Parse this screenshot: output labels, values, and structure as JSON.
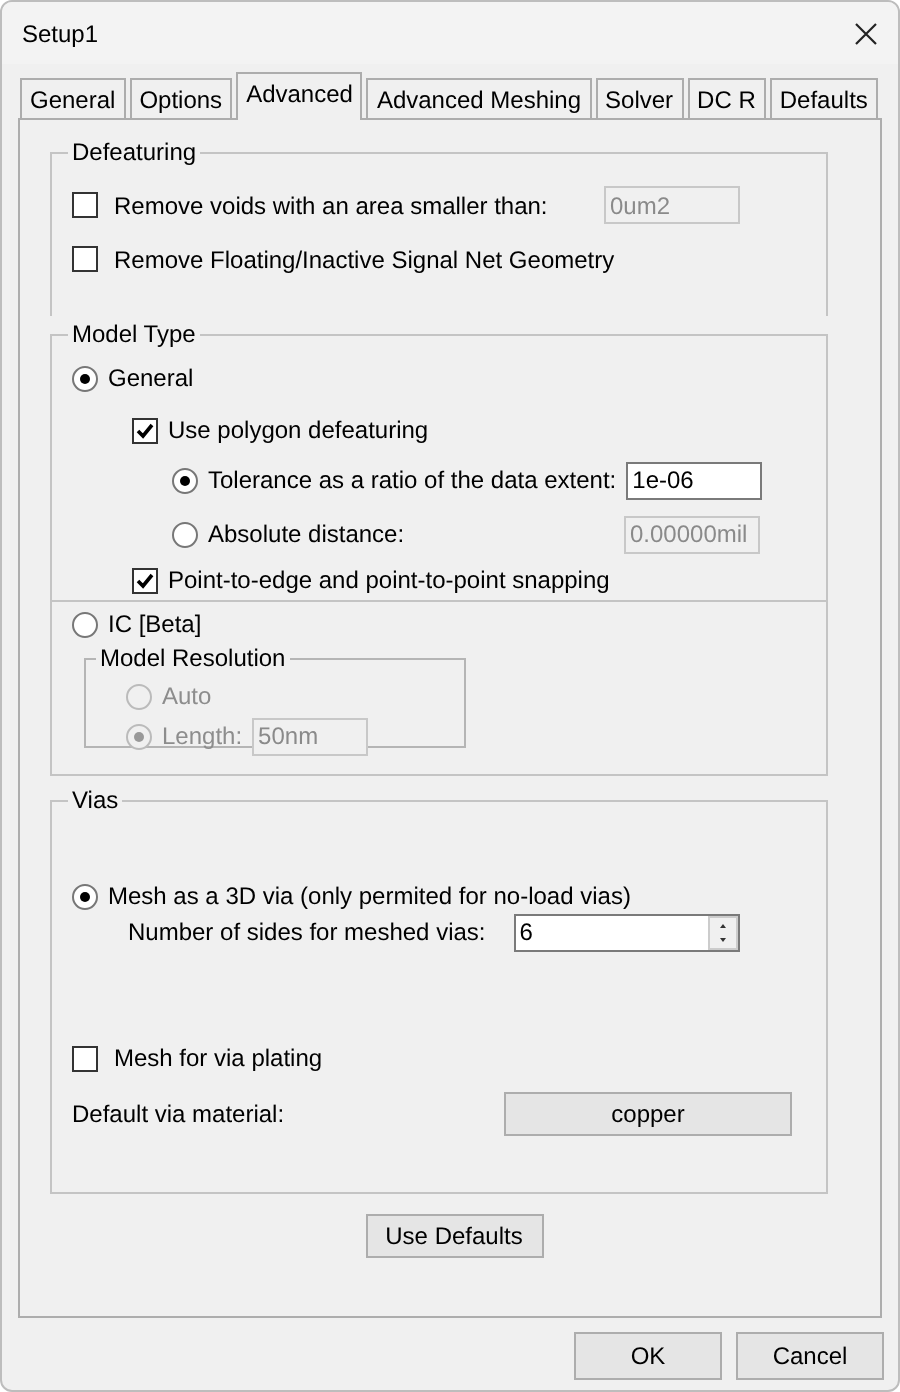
{
  "window": {
    "title": "Setup1"
  },
  "tabs": [
    {
      "label": "General",
      "selected": false
    },
    {
      "label": "Options",
      "selected": false
    },
    {
      "label": "Advanced",
      "selected": true
    },
    {
      "label": "Advanced Meshing",
      "selected": false
    },
    {
      "label": "Solver",
      "selected": false
    },
    {
      "label": "DC R",
      "selected": false
    },
    {
      "label": "Defaults",
      "selected": false
    }
  ],
  "defeaturing": {
    "title": "Defeaturing",
    "options": [
      {
        "label": "Remove voids with an area smaller than:",
        "checked": false,
        "value": "0um2",
        "disabled": true
      },
      {
        "label": "Remove Floating/Inactive Signal Net Geometry",
        "checked": false
      }
    ]
  },
  "model_type": {
    "title": "Model Type",
    "general": {
      "label": "General",
      "selected": true,
      "polygon": {
        "label": "Use polygon defeaturing",
        "checked": true
      },
      "tolerance": [
        {
          "label": "Tolerance as a ratio of the data extent:",
          "selected": true,
          "value": "1e-06",
          "disabled": false
        },
        {
          "label": "Absolute distance:",
          "selected": false,
          "value": "0.00000mil",
          "disabled": true
        }
      ],
      "snapping": {
        "label": "Point-to-edge and point-to-point snapping",
        "checked": true
      }
    },
    "ic": {
      "label": "IC [Beta]",
      "selected": false,
      "resolution": {
        "title": "Model Resolution",
        "disabled": true,
        "options": [
          {
            "label": "Auto",
            "selected": false
          },
          {
            "label": "Length:",
            "selected": true,
            "value": "50nm"
          }
        ]
      }
    }
  },
  "vias": {
    "title": "Vias",
    "mesh_3d": {
      "label": "Mesh as a 3D via (only permited for no-load vias)",
      "selected": true
    },
    "sides": {
      "label": "Number of sides for meshed vias:",
      "value": "6"
    },
    "plating": {
      "label": "Mesh for via plating",
      "checked": false
    },
    "material": {
      "label": "Default via material:",
      "button": "copper"
    }
  },
  "use_defaults": "Use Defaults",
  "buttons": [
    "OK",
    "Cancel"
  ]
}
